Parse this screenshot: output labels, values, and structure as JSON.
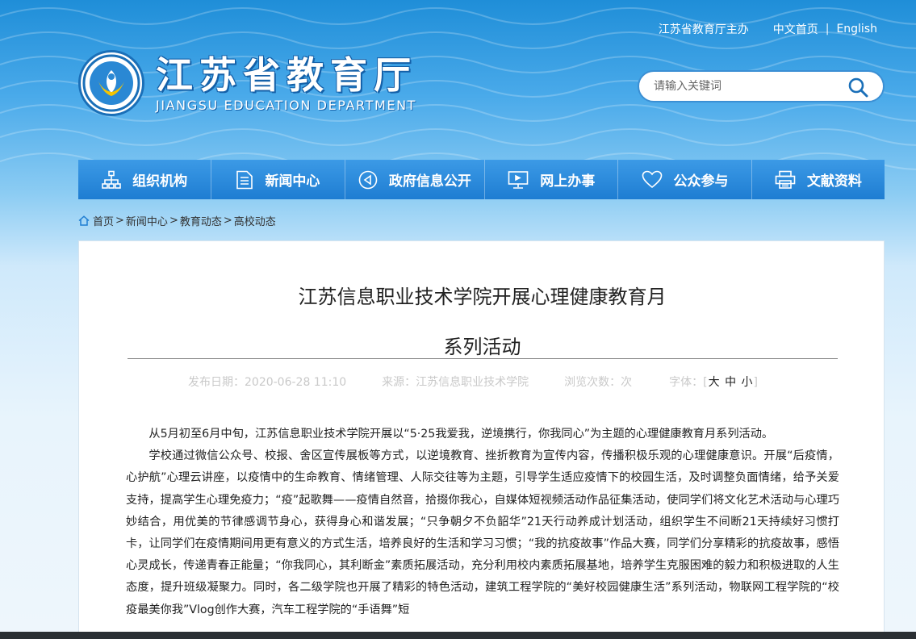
{
  "header": {
    "sponsor": "江苏省教育厅主办",
    "lang_cn": "中文首页",
    "lang_sep": "|",
    "lang_en": "English",
    "logo_cn": "江苏省教育厅",
    "logo_en": "JIANGSU EDUCATION DEPARTMENT",
    "search_placeholder": "请输入关键词"
  },
  "nav": {
    "items": [
      {
        "label": "组织机构",
        "icon": "org-chart-icon"
      },
      {
        "label": "新闻中心",
        "icon": "document-icon"
      },
      {
        "label": "政府信息公开",
        "icon": "megaphone-icon"
      },
      {
        "label": "网上办事",
        "icon": "monitor-icon"
      },
      {
        "label": "公众参与",
        "icon": "heart-icon"
      },
      {
        "label": "文献资料",
        "icon": "printer-icon"
      }
    ]
  },
  "breadcrumb": {
    "home": "首页",
    "items": [
      "新闻中心",
      "教育动态",
      "高校动态"
    ],
    "sep": ">"
  },
  "article": {
    "title_line1": "江苏信息职业技术学院开展心理健康教育月",
    "title_line2": "系列活动",
    "meta": {
      "date": "发布日期：2020-06-28 11:10",
      "source": "来源：江苏信息职业技术学院",
      "views": "浏览次数：次",
      "font_label": "字体：[",
      "font_large": "大",
      "font_medium": "中",
      "font_small": "小",
      "font_close": "]"
    },
    "paragraphs": [
      "从5月初至6月中旬，江苏信息职业技术学院开展以“5·25我爱我，逆境携行，你我同心”为主题的心理健康教育月系列活动。",
      "学校通过微信公众号、校报、舍区宣传展板等方式，以逆境教育、挫折教育为宣传内容，传播积极乐观的心理健康意识。开展“后疫情，心护航”心理云讲座，以疫情中的生命教育、情绪管理、人际交往等为主题，引导学生适应疫情下的校园生活，及时调整负面情绪，给予关爱支持，提高学生心理免疫力；“疫”起歌舞——疫情自然音，拾掇你我心，自媒体短视频活动作品征集活动，使同学们将文化艺术活动与心理巧妙结合，用优美的节律感调节身心，获得身心和谐发展；“只争朝夕不负韶华”21天行动养成计划活动，组织学生不间断21天持续好习惯打卡，让同学们在疫情期间用更有意义的方式生活，培养良好的生活和学习习惯；“我的抗疫故事”作品大赛，同学们分享精彩的抗疫故事，感悟心灵成长，传递青春正能量；“你我同心，其利断金”素质拓展活动，充分利用校内素质拓展基地，培养学生克服困难的毅力和积极进取的人生态度，提升班级凝聚力。同时，各二级学院也开展了精彩的特色活动，建筑工程学院的“美好校园健康生活”系列活动，物联网工程学院的“校疫最美你我”Vlog创作大赛，汽车工程学院的“手语舞”短"
    ]
  }
}
